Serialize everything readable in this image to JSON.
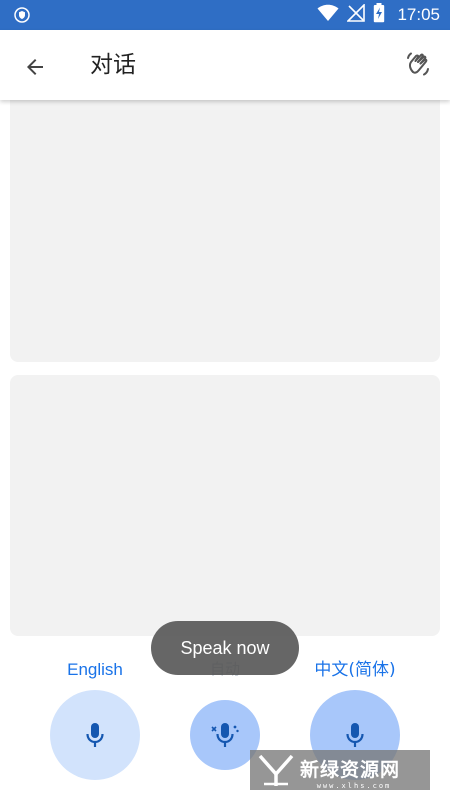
{
  "status_bar": {
    "time": "17:05",
    "icons": [
      "shield-icon",
      "wifi-icon",
      "no-signal-icon",
      "battery-charging-icon"
    ]
  },
  "app_bar": {
    "title": "对话",
    "back_icon": "arrow-left-icon",
    "action_icon": "hand-wave-icon"
  },
  "languages": {
    "left": "English",
    "auto": "自动",
    "right": "中文(简体)"
  },
  "toast": {
    "text": "Speak now"
  },
  "mic_buttons": {
    "left_icon": "mic-icon",
    "auto_icon": "auto-mic-icon",
    "right_icon": "mic-icon"
  },
  "watermark": {
    "text": "新绿资源网",
    "sub": "www.xlhs.com"
  },
  "colors": {
    "status_bar": "#2f6ec5",
    "accent": "#1a73e8",
    "mic_light": "#d2e3fc",
    "mic_active": "#a8c7fa",
    "panel": "#f2f2f2"
  }
}
